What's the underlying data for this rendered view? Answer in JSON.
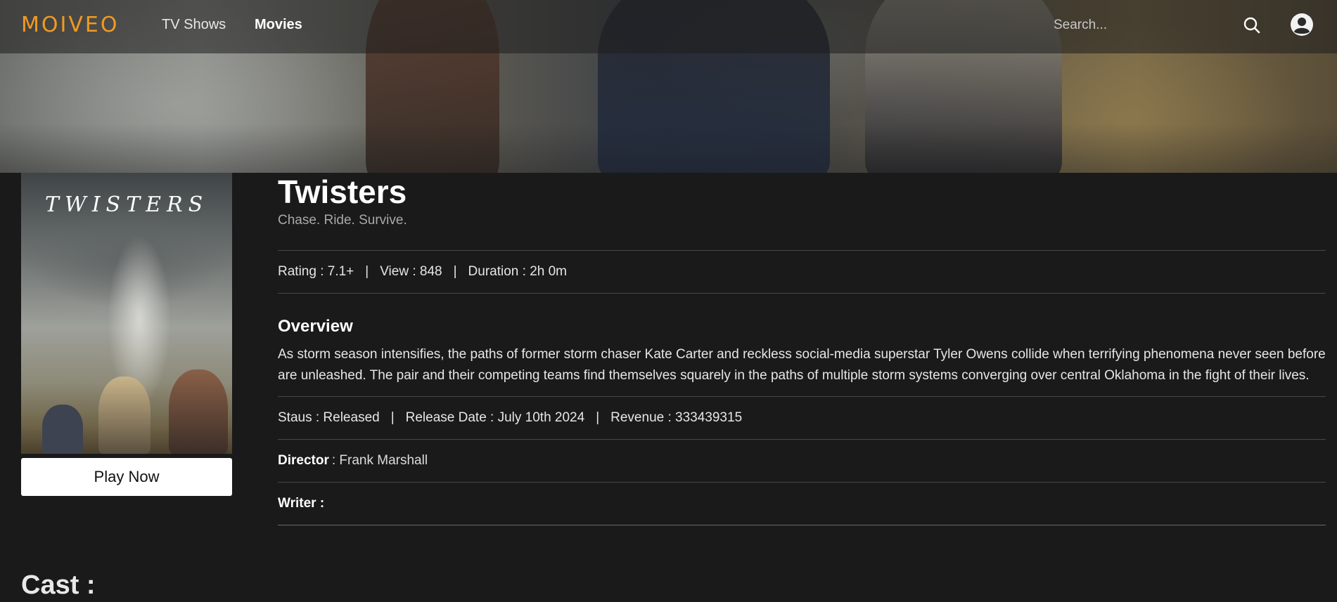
{
  "nav": {
    "logo": "MOIVEO",
    "links": [
      "TV Shows",
      "Movies"
    ],
    "active": "Movies",
    "search_placeholder": "Search..."
  },
  "poster": {
    "title_art": "TWISTERS"
  },
  "play_button": "Play Now",
  "movie": {
    "title": "Twisters",
    "tagline": "Chase. Ride. Survive.",
    "rating": "Rating : 7.1+",
    "views": "View : 848",
    "duration": "Duration : 2h 0m",
    "overview_heading": "Overview",
    "overview": "As storm season intensifies, the paths of former storm chaser Kate Carter and reckless social-media superstar Tyler Owens collide when terrifying phenomena never seen before are unleashed. The pair and their competing teams find themselves squarely in the paths of multiple storm systems converging over central Oklahoma in the fight of their lives.",
    "status": "Staus : Released",
    "release_date": "Release Date : July 10th 2024",
    "revenue": "Revenue : 333439315",
    "director_label": "Director",
    "director_value": ": Frank Marshall",
    "writer_label": "Writer :",
    "writer_value": ""
  },
  "separator": "|",
  "cast_heading": "Cast :",
  "colors": {
    "brand": "#f29a1f",
    "background": "#1a1a1a",
    "divider": "#474747",
    "muted": "#a9a9a9"
  }
}
